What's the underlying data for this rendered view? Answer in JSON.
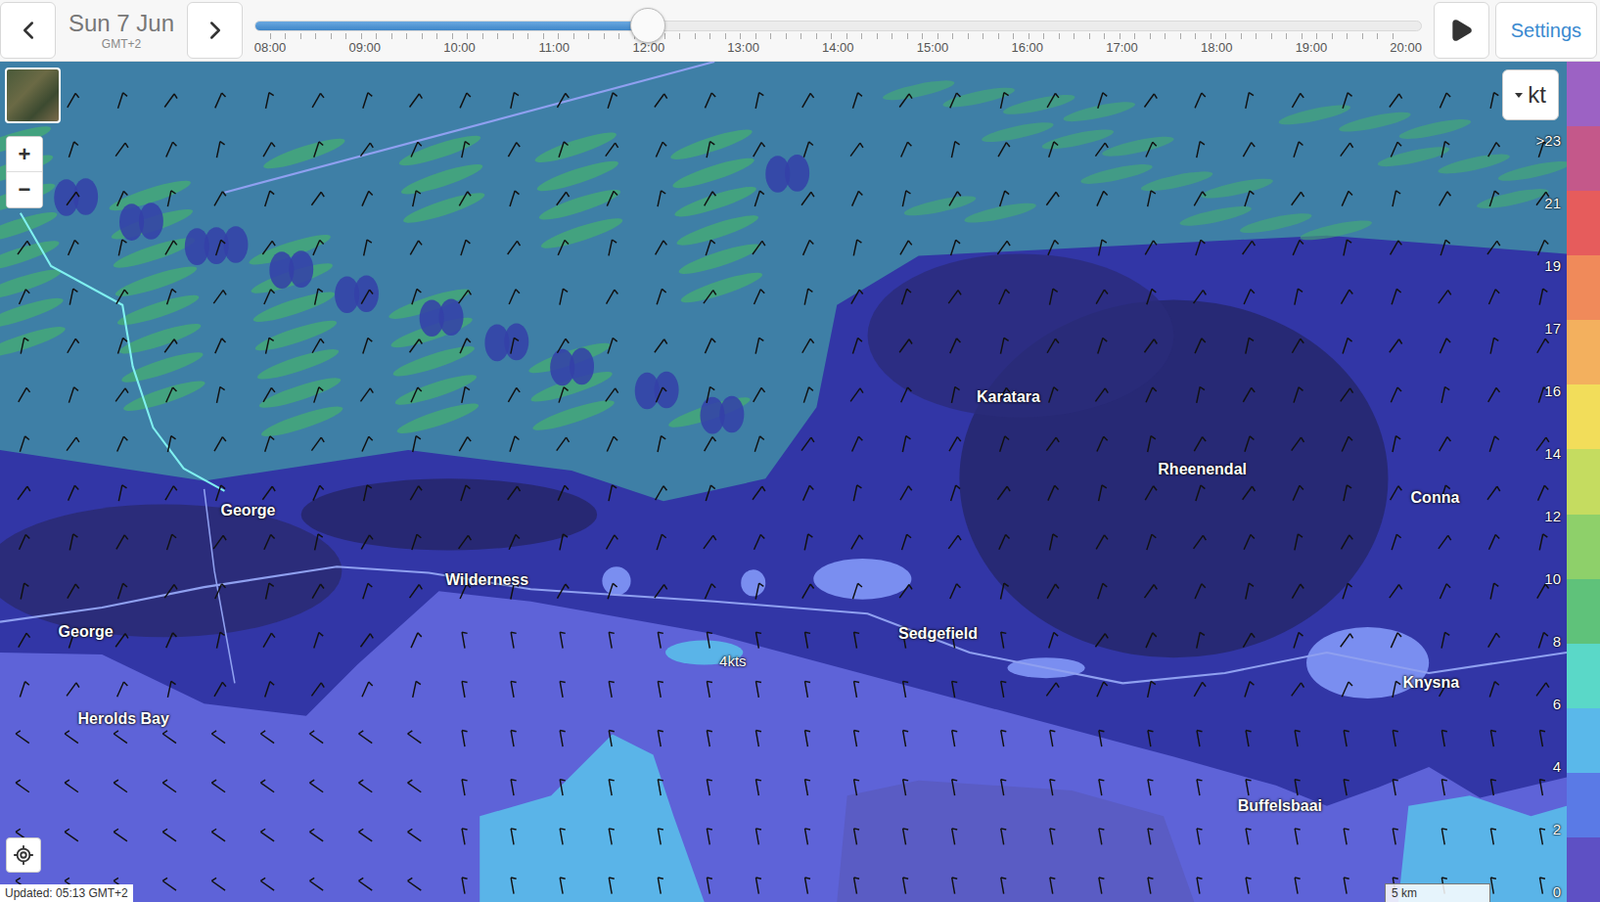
{
  "date": {
    "label": "Sun 7 Jun",
    "timezone": "GMT+2"
  },
  "timeline": {
    "ticks": [
      "08:00",
      "09:00",
      "10:00",
      "11:00",
      "12:00",
      "13:00",
      "14:00",
      "15:00",
      "16:00",
      "17:00",
      "18:00",
      "19:00",
      "20:00"
    ],
    "level": 0.337
  },
  "settings_button": "Settings",
  "zoom": [
    "+",
    "−"
  ],
  "units": "kt",
  "legend": [
    {
      "label": ">23",
      "color": "#9c62c4"
    },
    {
      "label": "21",
      "color": "#c4588a"
    },
    {
      "label": "19",
      "color": "#e65c5c"
    },
    {
      "label": "17",
      "color": "#f08a5a"
    },
    {
      "label": "16",
      "color": "#f3b05e"
    },
    {
      "label": "14",
      "color": "#f2dd5a"
    },
    {
      "label": "12",
      "color": "#c5dc60"
    },
    {
      "label": "10",
      "color": "#8ed06a"
    },
    {
      "label": "8",
      "color": "#5fc27a"
    },
    {
      "label": "6",
      "color": "#5ad8c8"
    },
    {
      "label": "4",
      "color": "#5ab8ea"
    },
    {
      "label": "2",
      "color": "#5a7ae6"
    },
    {
      "label": "0",
      "color": "#5e50c4"
    }
  ],
  "places": [
    {
      "name": "George",
      "kind": "town"
    },
    {
      "name": "Wilderness",
      "kind": "town"
    },
    {
      "name": "George",
      "kind": "town"
    },
    {
      "name": "Herolds Bay",
      "kind": "town"
    },
    {
      "name": "Karatara",
      "kind": "town"
    },
    {
      "name": "Rheenendal",
      "kind": "town"
    },
    {
      "name": "Conna",
      "kind": "town"
    },
    {
      "name": "Sedgefield",
      "kind": "town"
    },
    {
      "name": "Knysna",
      "kind": "town"
    },
    {
      "name": "Buffelsbaai",
      "kind": "town"
    },
    {
      "name": "4kts",
      "kind": "contour"
    }
  ],
  "scale": "5 km",
  "updated": "Updated: 05:13 GMT+2"
}
